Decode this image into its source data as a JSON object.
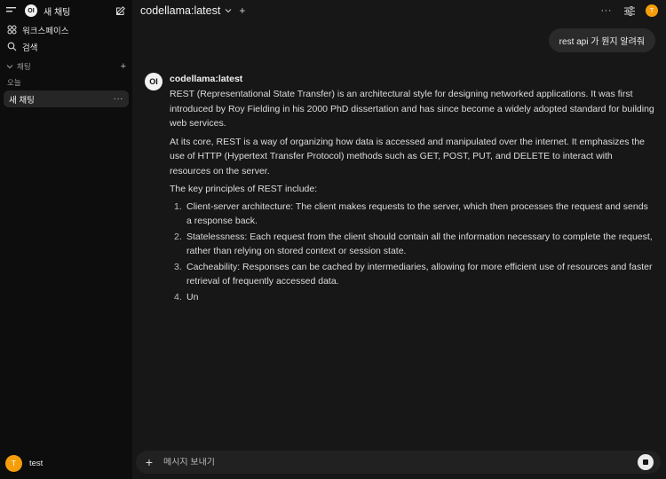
{
  "sidebar": {
    "new_chat_label": "새 채팅",
    "brand_logo": "OI",
    "items": [
      {
        "label": "워크스페이스",
        "icon": "workspace-icon"
      },
      {
        "label": "검색",
        "icon": "search-icon"
      }
    ],
    "section_label": "채팅",
    "date_group": "오늘",
    "chats": [
      {
        "label": "새 채팅",
        "more": "···"
      }
    ],
    "user": {
      "initial": "T",
      "name": "test"
    }
  },
  "topbar": {
    "model": "codellama:latest",
    "more": "···",
    "avatar_initial": "T"
  },
  "conversation": {
    "user_message": "rest api 가 뭔지 알려줘",
    "assistant": {
      "logo": "OI",
      "name": "codellama:latest",
      "paragraphs": [
        "REST (Representational State Transfer) is an architectural style for designing networked applications. It was first introduced by Roy Fielding in his 2000 PhD dissertation and has since become a widely adopted standard for building web services.",
        "At its core, REST is a way of organizing how data is accessed and manipulated over the internet. It emphasizes the use of HTTP (Hypertext Transfer Protocol) methods such as GET, POST, PUT, and DELETE to interact with resources on the server.",
        "The key principles of REST include:"
      ],
      "list": [
        {
          "num": "1.",
          "text": "Client-server architecture: The client makes requests to the server, which then processes the request and sends a response back."
        },
        {
          "num": "2.",
          "text": "Statelessness: Each request from the client should contain all the information necessary to complete the request, rather than relying on stored context or session state."
        },
        {
          "num": "3.",
          "text": "Cacheability: Responses can be cached by intermediaries, allowing for more efficient use of resources and faster retrieval of frequently accessed data."
        },
        {
          "num": "4.",
          "text": "Un"
        }
      ]
    }
  },
  "composer": {
    "placeholder": "메시지 보내기"
  },
  "colors": {
    "accent_avatar": "#f59e0b",
    "sidebar_bg": "#0d0d0d",
    "main_bg": "#171717"
  }
}
